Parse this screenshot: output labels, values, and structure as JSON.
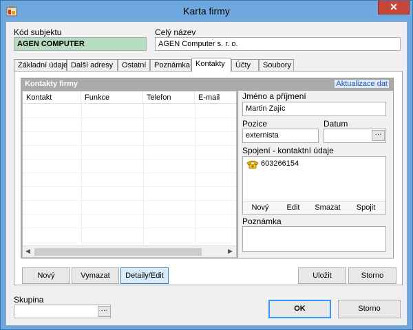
{
  "window": {
    "title": "Karta firmy",
    "close_glyph": "✕"
  },
  "top": {
    "code_label": "Kód subjektu",
    "code_value": "AGEN COMPUTER",
    "name_label": "Celý název",
    "name_value": "AGEN Computer s. r. o."
  },
  "tabs": [
    {
      "label": "Základní údaje"
    },
    {
      "label": "Další adresy"
    },
    {
      "label": "Ostatní"
    },
    {
      "label": "Poznámka"
    },
    {
      "label": "Kontakty",
      "active": true
    },
    {
      "label": "Účty"
    },
    {
      "label": "Soubory"
    }
  ],
  "contacts": {
    "title": "Kontakty firmy",
    "update_link": "Aktualizace dat",
    "columns": [
      "Kontakt",
      "Funkce",
      "Telefon",
      "E-mail"
    ],
    "rows": []
  },
  "detail": {
    "name_label": "Jméno a příjmení",
    "name_value": "Martin Zajíc",
    "position_label": "Pozice",
    "position_value": "externista",
    "date_label": "Datum",
    "date_value": "",
    "contacts_label": "Spojení -  kontaktní údaje",
    "contact_items": [
      {
        "icon": "phone-icon",
        "value": "603266154"
      }
    ],
    "contact_buttons": [
      "Nový",
      "Edit",
      "Smazat",
      "Spojit"
    ],
    "note_label": "Poznámka",
    "note_value": ""
  },
  "panel_buttons": {
    "new": "Nový",
    "delete": "Vymazat",
    "details": "Detaily/Edit",
    "save": "Uložit",
    "cancel": "Storno"
  },
  "bottom": {
    "group_label": "Skupina",
    "group_value": "",
    "ok": "OK",
    "cancel": "Storno"
  },
  "dots_glyph": "···",
  "colors": {
    "accent": "#3399ff",
    "title_bar": "#6fa8de",
    "code_field": "#b7dcbf",
    "close": "#c7463a"
  }
}
